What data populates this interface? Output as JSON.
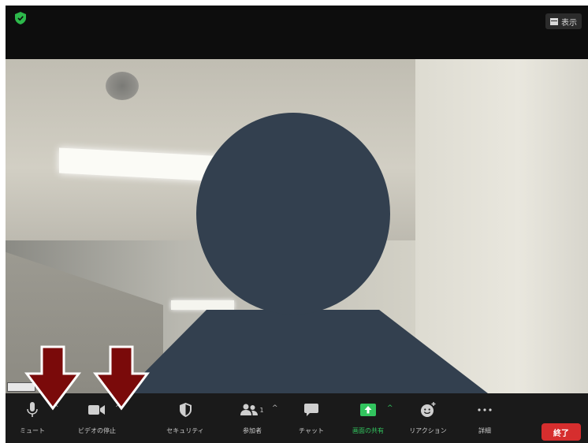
{
  "top_bar": {
    "view_label": "表示"
  },
  "toolbar": {
    "mute_label": "ミュート",
    "video_label": "ビデオの停止",
    "security_label": "セキュリティ",
    "participants_label": "参加者",
    "participants_count": "1",
    "chat_label": "チャット",
    "share_label": "画面の共有",
    "reactions_label": "リアクション",
    "more_label": "詳細",
    "end_label": "終了"
  },
  "colors": {
    "shield_green": "#2db84b",
    "share_green": "#32c45e",
    "end_red": "#d62e2e",
    "avatar_navy": "#33404f",
    "annotation_arrow": "#7a0a0a"
  },
  "icons": [
    "shield-icon",
    "view-icon",
    "microphone-icon",
    "video-camera-icon",
    "security-shield-icon",
    "participants-icon",
    "chat-bubble-icon",
    "share-screen-icon",
    "reaction-icon",
    "more-dots-icon",
    "down-arrow-icon"
  ]
}
